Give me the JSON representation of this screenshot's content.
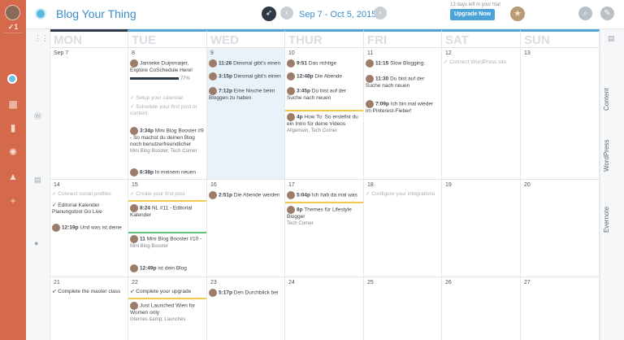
{
  "header": {
    "title": "Blog Your Thing",
    "date_range": "Sep 7 - Oct 5, 2015",
    "trial_text": "13 days left in your trial",
    "upgrade_label": "Upgrade Now"
  },
  "rail": {
    "check_count": "✓1"
  },
  "days": [
    "MON",
    "TUE",
    "WED",
    "THUR",
    "FRI",
    "SAT",
    "SUN"
  ],
  "sidebar_right": [
    "Content",
    "WordPress",
    "Evernote"
  ],
  "weeks": [
    {
      "dates": [
        "Sep 7",
        "8",
        "9",
        "10",
        "11",
        "12",
        "13"
      ],
      "events": {
        "tue": [
          {
            "author": "Janneke Duijnmaijer, Explore CoSchedule Here!",
            "progress": "77%"
          },
          {
            "text": "Setup your calendar"
          },
          {
            "text": "Schedule your first post or content"
          },
          {
            "time": "3:34p",
            "title": "Mini Blog Booster #9 - So machst du deinen Blog noch benutzerfreundlicher",
            "tag": "Mini Blog Booster, Tech Corner"
          },
          {
            "time": "6:38p",
            "title": "In meinem neuen"
          }
        ],
        "wed": [
          {
            "time": "11:26",
            "title": "Diesmal gibt's einen"
          },
          {
            "time": "3:15p",
            "title": "Diesmal gibt's einen"
          },
          {
            "time": "7:12p",
            "title": "Eine Nische beim Bloggen zu haben"
          }
        ],
        "thu": [
          {
            "time": "9:51",
            "title": "Das richtige"
          },
          {
            "time": "12:48p",
            "title": "Die Abende"
          },
          {
            "time": "3:45p",
            "title": "Du bist auf der Suche nach neuen"
          },
          {
            "time": "4p",
            "title": "How To: So erstellst du ein Intro für deine Videos",
            "tag": "Allgemein, Tech Corner"
          }
        ],
        "fri": [
          {
            "time": "11:15",
            "title": "Slow Blogging:"
          },
          {
            "time": "11:30",
            "title": "Du bist auf der Suche nach neuen"
          },
          {
            "time": "7:09p",
            "title": "Ich bin mal wieder im Pinterest-Fieber!"
          }
        ],
        "sat": [
          {
            "text": "Connect WordPress site"
          }
        ]
      }
    },
    {
      "dates": [
        "14",
        "15",
        "16",
        "17",
        "18",
        "19",
        "20"
      ],
      "events": {
        "mon": [
          {
            "text": "Connect social profiles"
          },
          {
            "text": "Editorial Kalender Planungstool Go Live"
          },
          {
            "time": "12:19p",
            "title": "Und was ist deine"
          }
        ],
        "tue": [
          {
            "text": "Create your first post"
          },
          {
            "time": "8:24",
            "title": "NL #11 - Editorial Kalender"
          },
          {
            "time": "11",
            "title": "Mini Blog Booster #10 -",
            "tag": "Mini Blog Booster"
          },
          {
            "time": "12:49p",
            "title": "ist dein Blog"
          }
        ],
        "wed": [
          {
            "time": "2:51p",
            "title": "Die Abende werden"
          }
        ],
        "thu": [
          {
            "time": "5:04p",
            "title": "Ich hab da mal was"
          },
          {
            "time": "8p",
            "title": "Themes für Lifestyle Blogger",
            "tag": "Tech Corner"
          }
        ],
        "fri": [
          {
            "text": "Configure your integrations"
          }
        ]
      }
    },
    {
      "dates": [
        "21",
        "22",
        "23",
        "24",
        "25",
        "26",
        "27"
      ],
      "events": {
        "mon": [
          {
            "text": "Complete the master class"
          }
        ],
        "tue": [
          {
            "text": "Complete your upgrade"
          },
          {
            "time": "",
            "title": "Just Launched Wien for Women only",
            "tag": "Internes &amp; Launches"
          }
        ],
        "wed": [
          {
            "time": "5:17p",
            "title": "Den Durchblick bei"
          }
        ]
      }
    }
  ]
}
